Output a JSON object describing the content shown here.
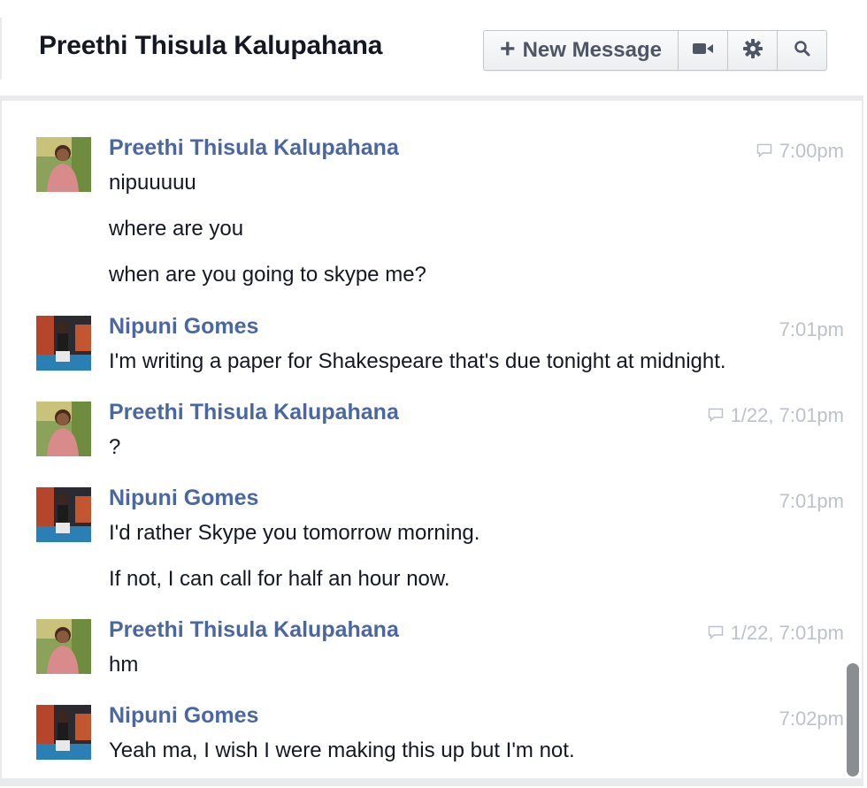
{
  "header": {
    "title": "Preethi Thisula Kalupahana",
    "new_message_label": "New Message",
    "icons": [
      "plus-icon",
      "video-call-icon",
      "gear-icon",
      "search-icon"
    ]
  },
  "colors": {
    "sender_name": "#4b67a1",
    "timestamp": "#bdc1c9",
    "body_text": "#141823"
  },
  "messages": [
    {
      "sender": "Preethi Thisula Kalupahana",
      "time": "7:00pm",
      "unread_icon": true,
      "lines": [
        "nipuuuuu",
        "where are you",
        "when are you going to skype me?"
      ]
    },
    {
      "sender": "Nipuni Gomes",
      "time": "7:01pm",
      "unread_icon": false,
      "lines": [
        "I'm writing a paper for Shakespeare that's due tonight at midnight."
      ]
    },
    {
      "sender": "Preethi Thisula Kalupahana",
      "time": "1/22, 7:01pm",
      "unread_icon": true,
      "lines": [
        "?"
      ]
    },
    {
      "sender": "Nipuni Gomes",
      "time": "7:01pm",
      "unread_icon": false,
      "lines": [
        "I'd rather Skype you tomorrow morning.",
        "If not, I can call for half an hour now."
      ]
    },
    {
      "sender": "Preethi Thisula Kalupahana",
      "time": "1/22, 7:01pm",
      "unread_icon": true,
      "lines": [
        "hm"
      ]
    },
    {
      "sender": "Nipuni Gomes",
      "time": "7:02pm",
      "unread_icon": false,
      "lines": [
        "Yeah ma, I wish I were making this up but I'm not."
      ]
    }
  ]
}
